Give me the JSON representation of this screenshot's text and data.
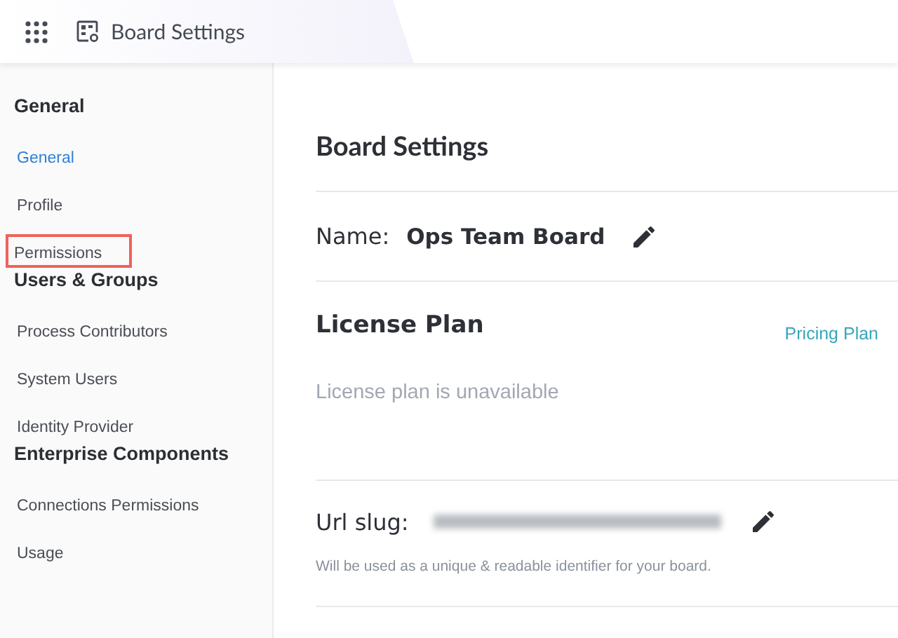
{
  "header": {
    "title": "Board Settings"
  },
  "sidebar": {
    "groups": [
      {
        "heading": "General",
        "items": [
          {
            "label": "General",
            "selected": true,
            "highlighted": false
          },
          {
            "label": "Profile",
            "selected": false,
            "highlighted": false
          },
          {
            "label": "Permissions",
            "selected": false,
            "highlighted": true
          }
        ]
      },
      {
        "heading": "Users & Groups",
        "items": [
          {
            "label": "Process Contributors",
            "selected": false,
            "highlighted": false
          },
          {
            "label": "System Users",
            "selected": false,
            "highlighted": false
          },
          {
            "label": "Identity Provider",
            "selected": false,
            "highlighted": false
          }
        ]
      },
      {
        "heading": "Enterprise Components",
        "items": [
          {
            "label": "Connections Permissions",
            "selected": false,
            "highlighted": false
          },
          {
            "label": "Usage",
            "selected": false,
            "highlighted": false
          }
        ]
      }
    ]
  },
  "main": {
    "title": "Board Settings",
    "name": {
      "label": "Name:",
      "value": "Ops Team Board"
    },
    "license": {
      "heading": "License Plan",
      "link": "Pricing Plan",
      "message": "License plan is unavailable"
    },
    "url_slug": {
      "label": "Url slug:",
      "value_redacted": true,
      "helper": "Will be used as a unique & readable identifier for your board."
    }
  }
}
